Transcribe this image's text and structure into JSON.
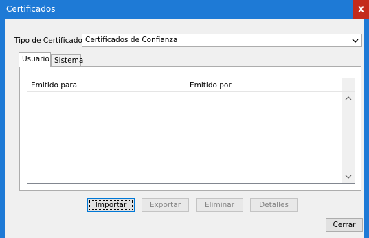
{
  "window": {
    "title": "Certificados",
    "close_glyph": "x",
    "accent_color": "#1e7ad6",
    "close_color": "#c42b1c"
  },
  "cert_type": {
    "label": "Tipo de Certificado:",
    "value": "Certificados de Confianza"
  },
  "tabs": [
    {
      "label": "Usuario",
      "active": true
    },
    {
      "label": "Sistema",
      "active": false
    }
  ],
  "list": {
    "columns": [
      "Emitido para",
      "Emitido por"
    ],
    "rows": []
  },
  "buttons": {
    "import": {
      "pre": "",
      "mnemonic": "I",
      "post": "mportar",
      "enabled": true,
      "default": true
    },
    "export": {
      "pre": "",
      "mnemonic": "E",
      "post": "xportar",
      "enabled": false
    },
    "delete": {
      "pre": "Eli",
      "mnemonic": "m",
      "post": "inar",
      "enabled": false
    },
    "details": {
      "pre": "",
      "mnemonic": "D",
      "post": "etalles",
      "enabled": false
    },
    "close_label": "Cerrar"
  },
  "icons": {
    "combo_arrow": "chevron-down-icon",
    "scroll_up": "chevron-up-icon",
    "scroll_down": "chevron-down-icon"
  }
}
